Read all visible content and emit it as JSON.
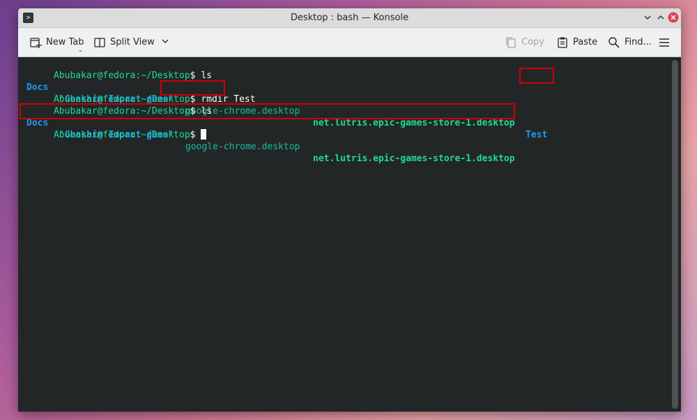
{
  "window": {
    "title": "Desktop : bash — Konsole",
    "app_icon_glyph": ">"
  },
  "toolbar": {
    "new_tab": "New Tab",
    "split_view": "Split View",
    "copy": "Copy",
    "paste": "Paste",
    "find": "Find..."
  },
  "terminal": {
    "lines": [
      {
        "user": "Abubakar@fedora",
        "path": ":~/Desktop",
        "sign": "$ ",
        "command": "ls"
      },
      {
        "items": [
          {
            "text": "Docs",
            "kind": "dir"
          },
          {
            "text": "'Genshin Impact game'",
            "kind": "dir"
          },
          {
            "text": "google-chrome.desktop",
            "kind": "file"
          },
          {
            "text": "net.lutris.epic-games-store-1.desktop",
            "kind": "exec"
          },
          {
            "text": "Test",
            "kind": "dir"
          }
        ]
      },
      {
        "user": "Abubakar@fedora",
        "path": ":~/Desktop",
        "sign": "$ ",
        "command": "rmdir Test"
      },
      {
        "user": "Abubakar@fedora",
        "path": ":~/Desktop",
        "sign": "$ ",
        "command": "ls"
      },
      {
        "items": [
          {
            "text": "Docs",
            "kind": "dir"
          },
          {
            "text": "'Genshin Impact game'",
            "kind": "dir"
          },
          {
            "text": "google-chrome.desktop",
            "kind": "file"
          },
          {
            "text": "net.lutris.epic-games-store-1.desktop",
            "kind": "exec"
          }
        ]
      },
      {
        "user": "Abubakar@fedora",
        "path": ":~/Desktop",
        "sign": "$ ",
        "command": ""
      }
    ]
  },
  "colors": {
    "terminal_bg": "#232627",
    "prompt": "#1cdc9a",
    "directory": "#1d99f3",
    "file": "#1abc9c",
    "highlight_box": "#d10000"
  }
}
